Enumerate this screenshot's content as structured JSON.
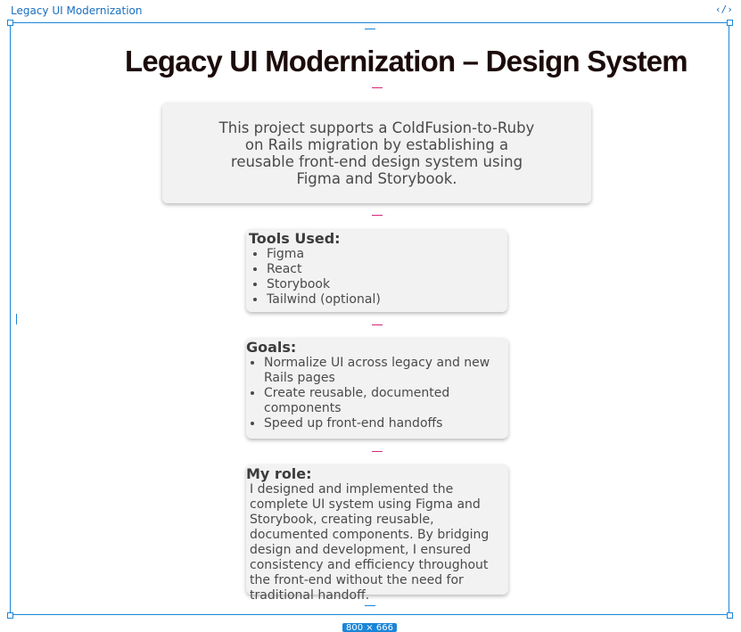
{
  "frame": {
    "title": "Legacy UI Modernization",
    "code_icon": "‹/›",
    "size_badge": "800 × 666"
  },
  "page": {
    "title": "Legacy UI Modernization – Design System",
    "intro": "This project supports a ColdFusion-to-Ruby on Rails migration by establishing a reusable front-end design system using Figma and Storybook."
  },
  "tools": {
    "heading": "Tools Used:",
    "items": [
      "Figma",
      "React",
      "Storybook",
      "Tailwind (optional)"
    ]
  },
  "goals": {
    "heading": "Goals:",
    "items": [
      "Normalize UI across legacy and new Rails pages",
      "Create reusable, documented components",
      "Speed up front-end handoffs"
    ]
  },
  "role": {
    "heading": "My role:",
    "text": "I designed and implemented the complete UI system using Figma and Storybook, creating reusable, documented components. By bridging design and development, I ensured consistency and efficiency throughout the front-end without the need for traditional handoff."
  },
  "colors": {
    "selection": "#1a86d8",
    "spacing_marker": "#d4267a",
    "card_bg": "#f2f2f2",
    "title_text": "#1c0b0b"
  }
}
